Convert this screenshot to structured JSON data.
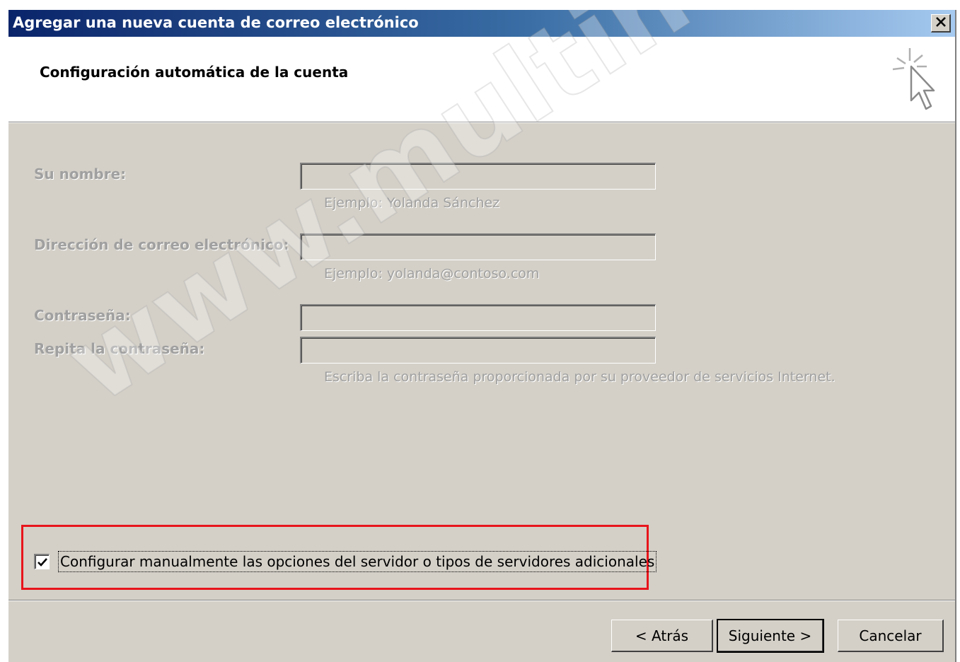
{
  "window": {
    "title": "Agregar una nueva cuenta de correo electrónico",
    "close_label": "✕"
  },
  "header": {
    "title": "Configuración automática de la cuenta",
    "icon": "wizard-cursor-icon"
  },
  "form": {
    "name": {
      "label": "Su nombre:",
      "value": "",
      "hint": "Ejemplo: Yolanda Sánchez"
    },
    "email": {
      "label": "Dirección de correo electrónico:",
      "value": "",
      "hint": "Ejemplo: yolanda@contoso.com"
    },
    "password": {
      "label": "Contraseña:",
      "value": ""
    },
    "password_repeat": {
      "label": "Repita la contraseña:",
      "value": "",
      "hint": "Escriba la contraseña proporcionada por su proveedor de servicios Internet."
    }
  },
  "manual_config": {
    "label": "Configurar manualmente las opciones del servidor o tipos de servidores adicionales",
    "checked": true
  },
  "buttons": {
    "back": "< Atrás",
    "next": "Siguiente >",
    "cancel": "Cancelar"
  },
  "watermark": "www.multihost.cl",
  "colors": {
    "highlight_border": "#e8151c",
    "dialog_bg": "#d4d0c8",
    "titlebar_start": "#0a246a"
  }
}
